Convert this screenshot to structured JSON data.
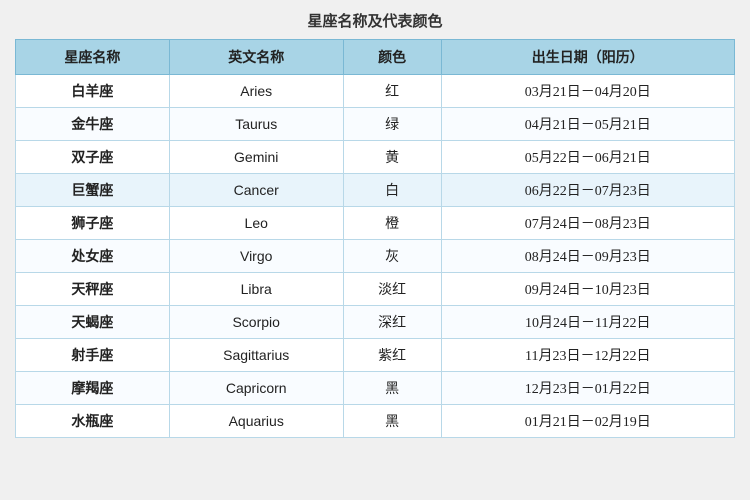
{
  "title": "星座名称及代表颜色",
  "headers": [
    "星座名称",
    "英文名称",
    "颜色",
    "出生日期（阳历）"
  ],
  "rows": [
    {
      "chinese": "白羊座",
      "english": "Aries",
      "color": "红",
      "date": "03月21日－04月20日"
    },
    {
      "chinese": "金牛座",
      "english": "Taurus",
      "color": "绿",
      "date": "04月21日－05月21日"
    },
    {
      "chinese": "双子座",
      "english": "Gemini",
      "color": "黄",
      "date": "05月22日－06月21日"
    },
    {
      "chinese": "巨蟹座",
      "english": "Cancer",
      "color": "白",
      "date": "06月22日－07月23日"
    },
    {
      "chinese": "狮子座",
      "english": "Leo",
      "color": "橙",
      "date": "07月24日－08月23日"
    },
    {
      "chinese": "处女座",
      "english": "Virgo",
      "color": "灰",
      "date": "08月24日－09月23日"
    },
    {
      "chinese": "天秤座",
      "english": "Libra",
      "color": "淡红",
      "date": "09月24日－10月23日"
    },
    {
      "chinese": "天蝎座",
      "english": "Scorpio",
      "color": "深红",
      "date": "10月24日－11月22日"
    },
    {
      "chinese": "射手座",
      "english": "Sagittarius",
      "color": "紫红",
      "date": "11月23日－12月22日"
    },
    {
      "chinese": "摩羯座",
      "english": "Capricorn",
      "color": "黑",
      "date": "12月23日－01月22日"
    },
    {
      "chinese": "水瓶座",
      "english": "Aquarius",
      "color": "黑",
      "date": "01月21日－02月19日"
    }
  ]
}
